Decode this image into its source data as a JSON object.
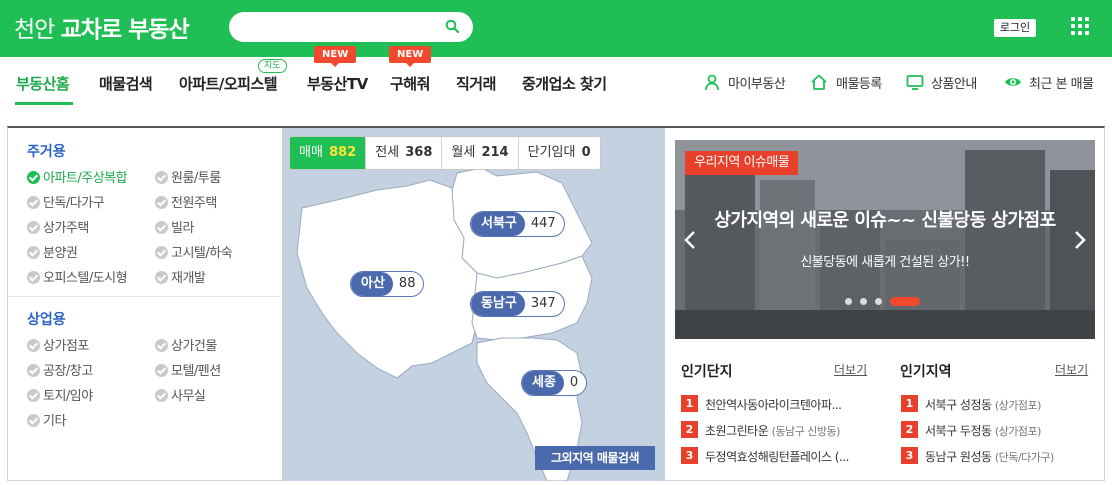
{
  "header": {
    "logo_prefix": "천안",
    "logo_brand": "교차로 부동산",
    "search_placeholder": "",
    "login_label": "로그인",
    "brand_color": "#1fbf55"
  },
  "nav": {
    "items": [
      "부동산홈",
      "매물검색",
      "아파트/오피스텔",
      "부동산TV",
      "구해줘",
      "직거래",
      "중개업소 찾기"
    ],
    "badge_map": "지도",
    "badge_new": "NEW",
    "util": [
      "마이부동산",
      "매물등록",
      "상품안내",
      "최근 본 매물"
    ]
  },
  "categories": {
    "residential_title": "주거용",
    "residential": [
      {
        "label": "아파트/주상복합",
        "checked": true
      },
      {
        "label": "원룸/투룸",
        "checked": false
      },
      {
        "label": "단독/다가구",
        "checked": false
      },
      {
        "label": "전원주택",
        "checked": false
      },
      {
        "label": "상가주택",
        "checked": false
      },
      {
        "label": "빌라",
        "checked": false
      },
      {
        "label": "분양권",
        "checked": false
      },
      {
        "label": "고시텔/하숙",
        "checked": false
      },
      {
        "label": "오피스텔/도시형",
        "checked": false
      },
      {
        "label": "재개발",
        "checked": false
      }
    ],
    "commercial_title": "상업용",
    "commercial": [
      {
        "label": "상가점포",
        "checked": false
      },
      {
        "label": "상가건물",
        "checked": false
      },
      {
        "label": "공장/창고",
        "checked": false
      },
      {
        "label": "모텔/펜션",
        "checked": false
      },
      {
        "label": "토지/임야",
        "checked": false
      },
      {
        "label": "사무실",
        "checked": false
      },
      {
        "label": "기타",
        "checked": false
      }
    ]
  },
  "map": {
    "tabs": [
      {
        "label": "매매",
        "count": "882",
        "active": true
      },
      {
        "label": "전세",
        "count": "368",
        "active": false
      },
      {
        "label": "월세",
        "count": "214",
        "active": false
      },
      {
        "label": "단기임대",
        "count": "0",
        "active": false
      }
    ],
    "regions": [
      {
        "name": "서북구",
        "count": "447"
      },
      {
        "name": "아산",
        "count": "88"
      },
      {
        "name": "동남구",
        "count": "347"
      },
      {
        "name": "세종",
        "count": "0"
      }
    ],
    "other_button": "그외지역 매물검색"
  },
  "banner": {
    "tag": "우리지역 이슈매물",
    "title": "상가지역의 새로운 이슈~~ 신불당동 상가점포",
    "subtitle": "신불당동에 새롭게 건설된 상가!!",
    "slide_count": 4,
    "active_slide": 4
  },
  "popular": {
    "complex_title": "인기단지",
    "region_title": "인기지역",
    "more_label": "더보기",
    "complexes": [
      {
        "rank": "1",
        "name": "천안역사동아라이크텐아파...",
        "type": ""
      },
      {
        "rank": "2",
        "name": "초원그린타운",
        "type": "(동남구 신방동)"
      },
      {
        "rank": "3",
        "name": "두정역효성해링턴플레이스 (...",
        "type": ""
      }
    ],
    "regions": [
      {
        "rank": "1",
        "name": "서북구 성정동",
        "type": "(상가점포)"
      },
      {
        "rank": "2",
        "name": "서북구 두정동",
        "type": "(상가점포)"
      },
      {
        "rank": "3",
        "name": "동남구 원성동",
        "type": "(단독/다가구)"
      }
    ]
  }
}
